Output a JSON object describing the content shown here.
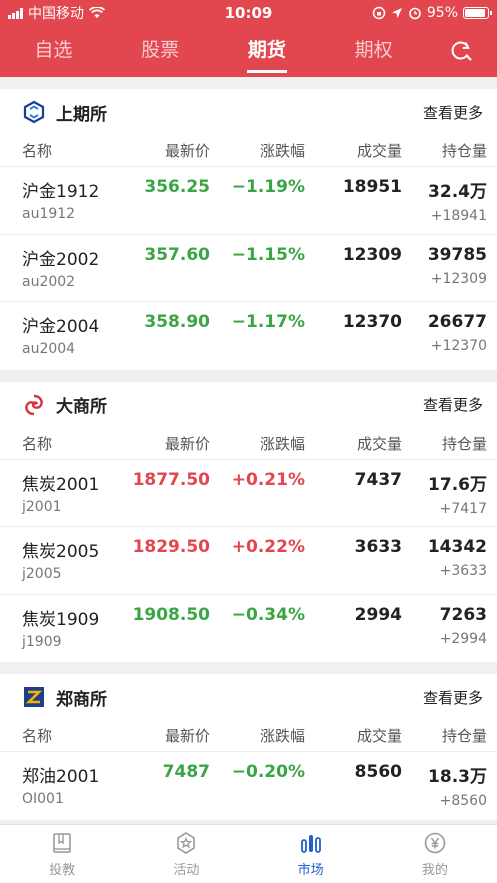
{
  "status": {
    "carrier": "中国移动",
    "time": "10:09",
    "battery": "95%"
  },
  "tabs": [
    {
      "label": "自选",
      "active": false
    },
    {
      "label": "股票",
      "active": false
    },
    {
      "label": "期货",
      "active": true
    },
    {
      "label": "期权",
      "active": false
    }
  ],
  "columns": {
    "name": "名称",
    "price": "最新价",
    "change": "涨跌幅",
    "volume": "成交量",
    "holding": "持仓量"
  },
  "more_label": "查看更多",
  "exchanges": [
    {
      "name": "上期所",
      "rows": [
        {
          "name": "沪金1912",
          "code": "au1912",
          "price": "356.25",
          "change": "−1.19%",
          "dir": "down",
          "volume": "18951",
          "holding": "32.4万",
          "holding_change": "+18941"
        },
        {
          "name": "沪金2002",
          "code": "au2002",
          "price": "357.60",
          "change": "−1.15%",
          "dir": "down",
          "volume": "12309",
          "holding": "39785",
          "holding_change": "+12309"
        },
        {
          "name": "沪金2004",
          "code": "au2004",
          "price": "358.90",
          "change": "−1.17%",
          "dir": "down",
          "volume": "12370",
          "holding": "26677",
          "holding_change": "+12370"
        }
      ]
    },
    {
      "name": "大商所",
      "rows": [
        {
          "name": "焦炭2001",
          "code": "j2001",
          "price": "1877.50",
          "change": "+0.21%",
          "dir": "up",
          "volume": "7437",
          "holding": "17.6万",
          "holding_change": "+7417"
        },
        {
          "name": "焦炭2005",
          "code": "j2005",
          "price": "1829.50",
          "change": "+0.22%",
          "dir": "up",
          "volume": "3633",
          "holding": "14342",
          "holding_change": "+3633"
        },
        {
          "name": "焦炭1909",
          "code": "j1909",
          "price": "1908.50",
          "change": "−0.34%",
          "dir": "down",
          "volume": "2994",
          "holding": "7263",
          "holding_change": "+2994"
        }
      ]
    },
    {
      "name": "郑商所",
      "rows": [
        {
          "name": "郑油2001",
          "code": "OI001",
          "price": "7487",
          "change": "−0.20%",
          "dir": "down",
          "volume": "8560",
          "holding": "18.3万",
          "holding_change": "+8560"
        }
      ]
    }
  ],
  "bottom_nav": [
    {
      "label": "投教",
      "icon": "book-icon",
      "active": false
    },
    {
      "label": "活动",
      "icon": "star-badge-icon",
      "active": false
    },
    {
      "label": "市场",
      "icon": "market-bars-icon",
      "active": true
    },
    {
      "label": "我的",
      "icon": "yen-coin-icon",
      "active": false
    }
  ],
  "colors": {
    "brand": "#e2474f",
    "down": "#3aa544",
    "up": "#e2474f",
    "nav_active": "#1f5fcc"
  }
}
